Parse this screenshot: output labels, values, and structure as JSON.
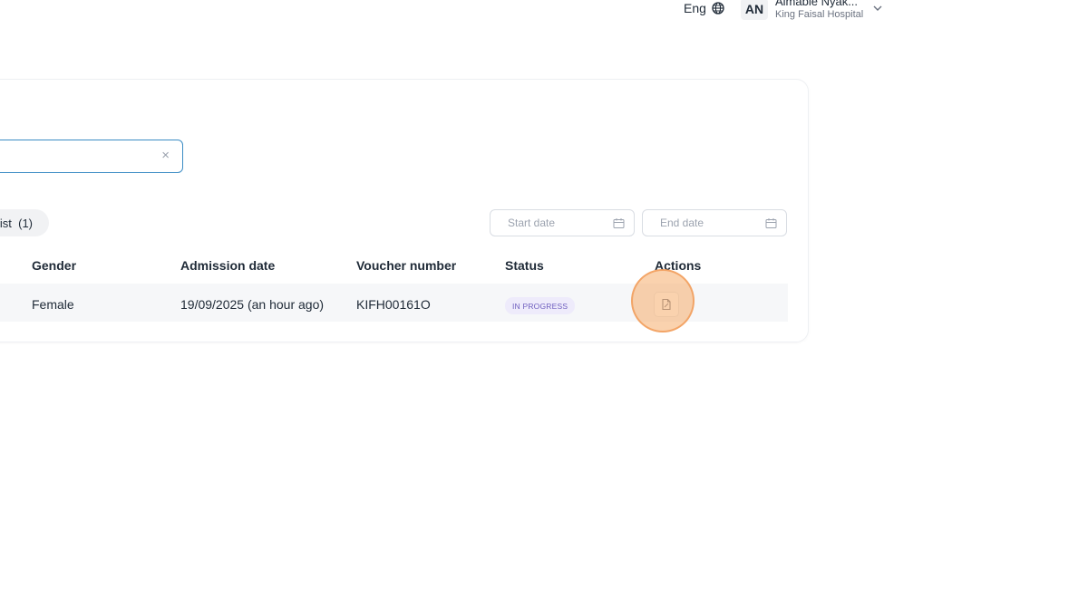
{
  "header": {
    "language": "Eng",
    "user_initials": "AN",
    "user_name": "Aimable Nyak...",
    "user_org": "King Faisal Hospital"
  },
  "search": {
    "value": "",
    "placeholder": ""
  },
  "list_tab": {
    "label": "List",
    "count": "(1)"
  },
  "filters": {
    "start_placeholder": "Start date",
    "end_placeholder": "End date"
  },
  "table": {
    "headers": {
      "gender": "Gender",
      "admission": "Admission date",
      "voucher": "Voucher number",
      "status": "Status",
      "actions": "Actions"
    },
    "rows": [
      {
        "gender": "Female",
        "admission": "19/09/2025 (an hour ago)",
        "voucher": "KIFH00161O",
        "status": "IN PROGRESS"
      }
    ]
  },
  "colors": {
    "accent": "#3b8cc4",
    "status_bg": "#eeebfb",
    "status_text": "#6f5fbf",
    "highlight": "#f6ad6c"
  }
}
